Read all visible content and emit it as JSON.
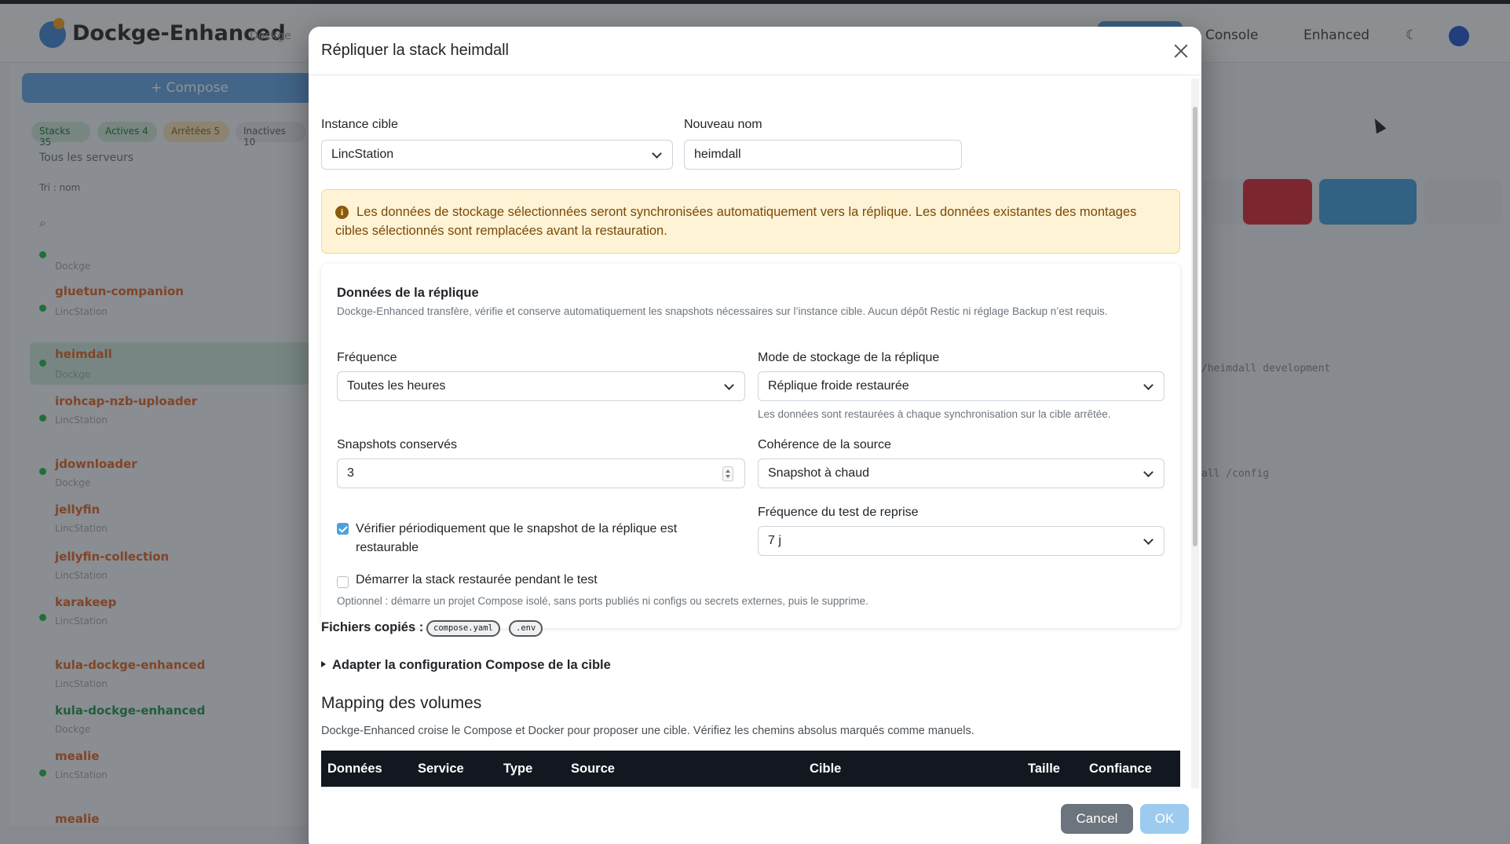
{
  "background": {
    "app_title": "Dockge-Enhanced",
    "version": "Dockge",
    "nav": [
      "Console",
      "Enhanced"
    ],
    "compose_button": "+ Compose",
    "filters": [
      "Stacks 35",
      "Actives 4",
      "Arrêtées 5",
      "Inactives 10"
    ],
    "server_label": "Tous les serveurs",
    "filter_label": "Tri : nom",
    "stacks": [
      {
        "name": "",
        "sub": "Dockge"
      },
      {
        "name": "gluetun-companion",
        "sub": "LincStation"
      },
      {
        "name": "heimdall",
        "sub": "Dockge"
      },
      {
        "name": "irohcap-nzb-uploader",
        "sub": "LincStation"
      },
      {
        "name": "jdownloader",
        "sub": "Dockge"
      },
      {
        "name": "jellyfin",
        "sub": "LincStation"
      },
      {
        "name": "jellyfin-collection",
        "sub": "LincStation"
      },
      {
        "name": "karakeep",
        "sub": "LincStation"
      },
      {
        "name": "kula-dockge-enhanced",
        "sub": "LincStation"
      },
      {
        "name": "kula-dockge-enhanced",
        "sub": "Dockge"
      },
      {
        "name": "mealie",
        "sub": "LincStation"
      },
      {
        "name": "mealie",
        "sub": ""
      }
    ],
    "terminal_lines": [
      "/heimdall development",
      "all /config"
    ]
  },
  "modal": {
    "title": "Répliquer la stack heimdall",
    "target_label": "Instance cible",
    "target_value": "LincStation",
    "name_label": "Nouveau nom",
    "name_value": "heimdall",
    "alert": "Les données de stockage sélectionnées seront synchronisées automatiquement vers la réplique. Les données existantes des montages cibles sélectionnés sont remplacées avant la restauration.",
    "card": {
      "title": "Données de la réplique",
      "description": "Dockge-Enhanced transfère, vérifie et conserve automatiquement les snapshots nécessaires sur l’instance cible. Aucun dépôt Restic ni réglage Backup n’est requis.",
      "frequency_label": "Fréquence",
      "frequency_value": "Toutes les heures",
      "storage_mode_label": "Mode de stockage de la réplique",
      "storage_mode_value": "Réplique froide restaurée",
      "storage_mode_hint": "Les données sont restaurées à chaque synchronisation sur la cible arrêtée.",
      "snapshots_label": "Snapshots conservés",
      "snapshots_value": "3",
      "coherence_label": "Cohérence de la source",
      "coherence_value": "Snapshot à chaud",
      "test_freq_label": "Fréquence du test de reprise",
      "test_freq_value": "7 j",
      "verify_label": "Vérifier périodiquement que le snapshot de la réplique est restaurable",
      "verify_checked": true,
      "start_label": "Démarrer la stack restaurée pendant le test",
      "start_checked": false,
      "optional_hint": "Optionnel : démarre un projet Compose isolé, sans ports publiés ni configs ou secrets externes, puis le supprime."
    },
    "files_label": "Fichiers copiés :",
    "files": [
      "compose.yaml",
      ".env"
    ],
    "adapt_label": "Adapter la configuration Compose de la cible",
    "mapping_title": "Mapping des volumes",
    "mapping_hint": "Dockge-Enhanced croise le Compose et Docker pour proposer une cible. Vérifiez les chemins absolus marqués comme manuels.",
    "table_headers": [
      "Données",
      "Service",
      "Type",
      "Source",
      "Cible",
      "Taille",
      "Confiance"
    ],
    "cancel": "Cancel",
    "ok": "OK"
  },
  "colors": {
    "accent": "#4aa3df",
    "alert_bg": "#fff3d6",
    "alert_text": "#7a4a06",
    "table_head": "#121720",
    "cancel_bg": "#6c757d",
    "ok_bg": "#9ccbef"
  }
}
